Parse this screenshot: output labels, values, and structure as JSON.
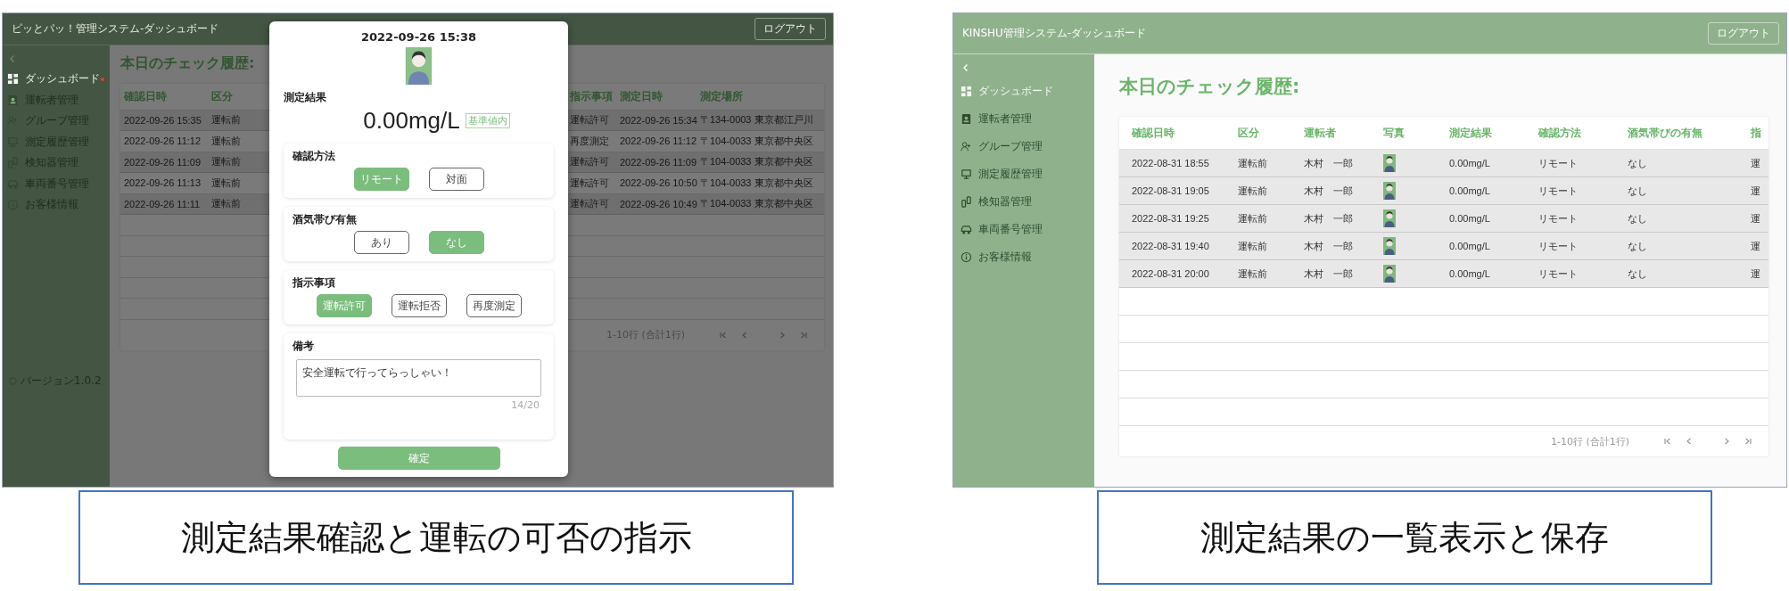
{
  "screens": [
    {
      "app_title": "ピッとパッ！管理システム-ダッシュボード",
      "logout": "ログアウト",
      "striped": true,
      "sidebar": {
        "items": [
          {
            "label": "ダッシュボード",
            "selected": true,
            "alert": true
          },
          {
            "label": "運転者管理",
            "selected": false,
            "alert": false
          },
          {
            "label": "グループ管理",
            "selected": false,
            "alert": false
          },
          {
            "label": "測定履歴管理",
            "selected": false,
            "alert": false
          },
          {
            "label": "検知器管理",
            "selected": false,
            "alert": false
          },
          {
            "label": "車両番号管理",
            "selected": false,
            "alert": false
          },
          {
            "label": "お客様情報",
            "selected": false,
            "alert": false
          }
        ],
        "version": "バージョン1.0.2"
      },
      "heading": "本日のチェック履歴:",
      "table": {
        "columns": [
          "確認日時",
          "区分",
          "指示事項",
          "測定日時",
          "測定場所"
        ],
        "rows": [
          {
            "cells": [
              "2022-09-26 15:35",
              "運転前",
              "運転許可",
              "2022-09-26 15:34",
              "〒134-0003 東京都江戸川"
            ]
          },
          {
            "cells": [
              "2022-09-26 11:12",
              "運転前",
              "再度測定",
              "2022-09-26 11:12",
              "〒104-0033 東京都中央区"
            ]
          },
          {
            "cells": [
              "2022-09-26 11:09",
              "運転前",
              "運転許可",
              "2022-09-26 11:09",
              "〒104-0033 東京都中央区"
            ]
          },
          {
            "cells": [
              "2022-09-26 11:13",
              "運転前",
              "運転許可",
              "2022-09-26 10:50",
              "〒104-0033 東京都中央区"
            ]
          },
          {
            "cells": [
              "2022-09-26 11:11",
              "運転前",
              "運転許可",
              "2022-09-26 10:49",
              "〒104-0033 東京都中央区"
            ]
          }
        ],
        "pagination": "1-10行 (合計1行)"
      },
      "dialog": {
        "datetime": "2022-09-26 15:38",
        "result_label": "測定結果",
        "result": "0.00mg/L",
        "result_badge": "基準値内",
        "groups": [
          {
            "label": "確認方法",
            "options": [
              {
                "label": "リモート",
                "selected": true
              },
              {
                "label": "対面",
                "selected": false
              }
            ]
          },
          {
            "label": "酒気帯び有無",
            "options": [
              {
                "label": "あり",
                "selected": false
              },
              {
                "label": "なし",
                "selected": true
              }
            ]
          },
          {
            "label": "指示事項",
            "options": [
              {
                "label": "運転許可",
                "selected": true
              },
              {
                "label": "運転拒否",
                "selected": false
              },
              {
                "label": "再度測定",
                "selected": false
              }
            ]
          }
        ],
        "note": {
          "label": "備考",
          "value": "安全運転で行ってらっしゃい！",
          "counter": "14/20"
        },
        "confirm": "確定"
      },
      "caption": "測定結果確認と運転の可否の指示"
    },
    {
      "app_title": "KINSHU管理システム-ダッシュボード",
      "logout": "ログアウト",
      "striped": false,
      "sidebar": {
        "items": [
          {
            "label": "ダッシュボード",
            "selected": true,
            "alert": false
          },
          {
            "label": "運転者管理",
            "selected": false,
            "alert": false
          },
          {
            "label": "グループ管理",
            "selected": false,
            "alert": false
          },
          {
            "label": "測定履歴管理",
            "selected": false,
            "alert": false
          },
          {
            "label": "検知器管理",
            "selected": false,
            "alert": false
          },
          {
            "label": "車両番号管理",
            "selected": false,
            "alert": false
          },
          {
            "label": "お客様情報",
            "selected": false,
            "alert": false
          }
        ]
      },
      "heading": "本日のチェック履歴:",
      "table": {
        "columns": [
          "確認日時",
          "区分",
          "運転者",
          "写真",
          "測定結果",
          "確認方法",
          "酒気帯びの有無",
          "指"
        ],
        "rows": [
          {
            "cells": [
              "2022-08-31 18:55",
              "運転前",
              "木村　一郎",
              {
                "kind": "picture"
              },
              "0.00mg/L",
              "リモート",
              "なし",
              "運"
            ]
          },
          {
            "cells": [
              "2022-08-31 19:05",
              "運転前",
              "木村　一郎",
              {
                "kind": "picture"
              },
              "0.00mg/L",
              "リモート",
              "なし",
              "運"
            ]
          },
          {
            "cells": [
              "2022-08-31 19:25",
              "運転前",
              "木村　一郎",
              {
                "kind": "picture"
              },
              "0.00mg/L",
              "リモート",
              "なし",
              "運"
            ]
          },
          {
            "cells": [
              "2022-08-31 19:40",
              "運転前",
              "木村　一郎",
              {
                "kind": "picture"
              },
              "0.00mg/L",
              "リモート",
              "なし",
              "運"
            ]
          },
          {
            "cells": [
              "2022-08-31 20:00",
              "運転前",
              "木村　一郎",
              {
                "kind": "picture"
              },
              "0.00mg/L",
              "リモート",
              "なし",
              "運"
            ]
          }
        ],
        "pagination": "1-10行 (合計1行)"
      },
      "caption": "測定結果の一覧表示と保存"
    }
  ]
}
